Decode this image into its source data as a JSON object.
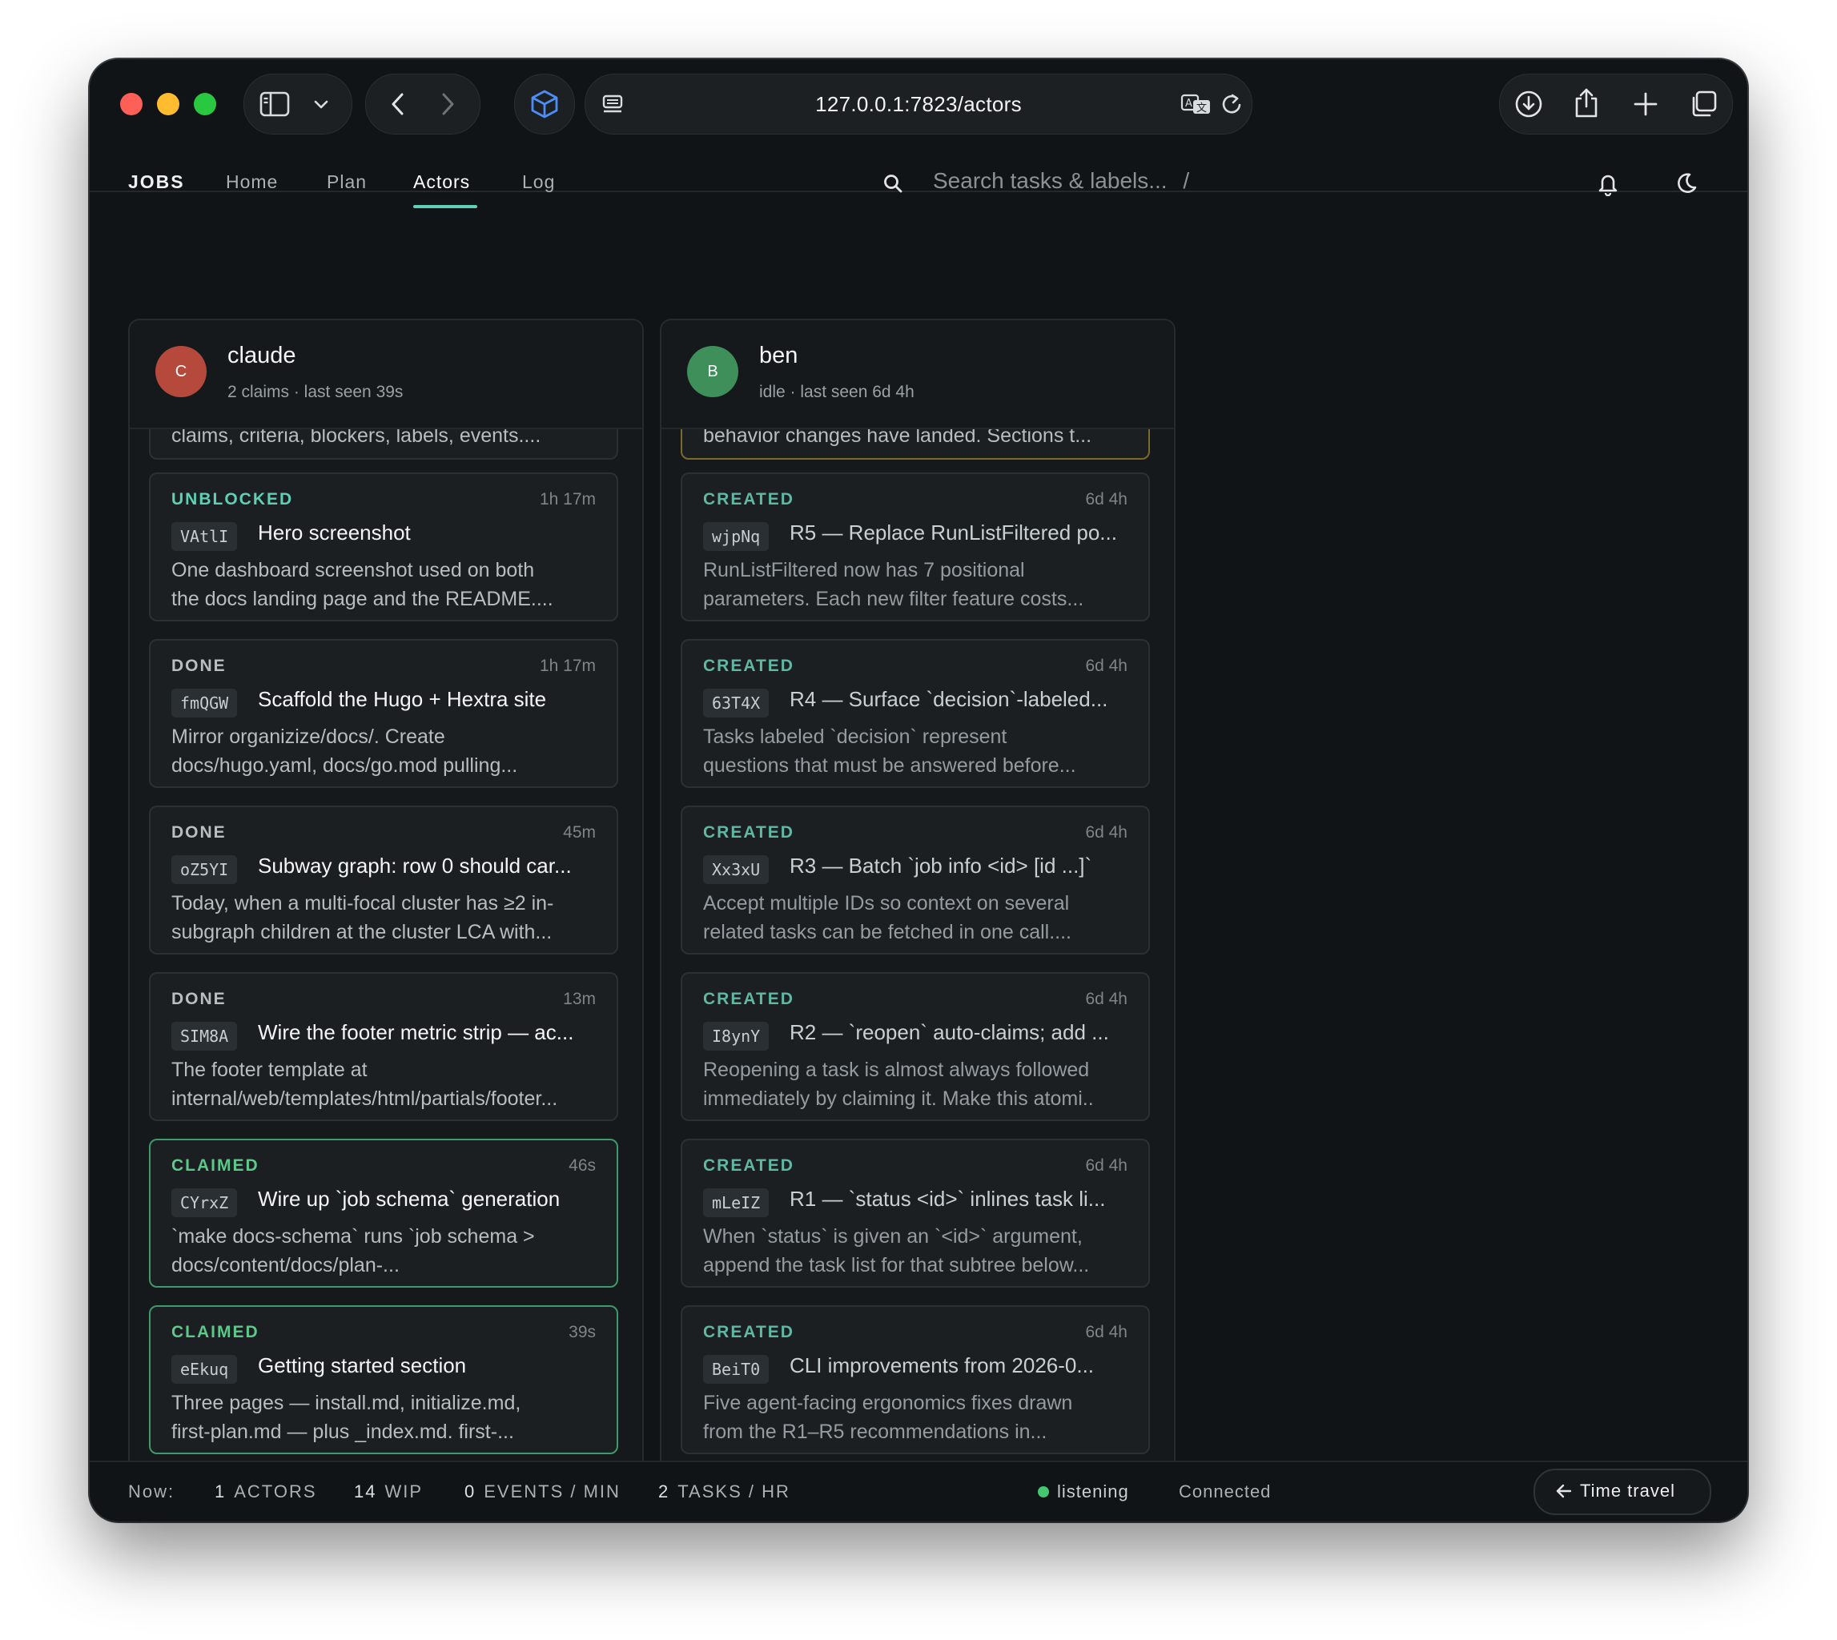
{
  "browser": {
    "url": "127.0.0.1:7823/actors"
  },
  "nav": {
    "brand": "JOBS",
    "items": [
      {
        "label": "Home"
      },
      {
        "label": "Plan"
      },
      {
        "label": "Actors",
        "active": true
      },
      {
        "label": "Log"
      }
    ],
    "search_placeholder": "Search tasks & labels...",
    "search_shortcut": "/"
  },
  "icons": {
    "sidebar": "sidebar-icon",
    "back": "chevron-left-icon",
    "forward": "chevron-right-icon",
    "extension": "cube-icon",
    "reader": "reader-icon",
    "translate": "translate-icon",
    "reload": "reload-icon",
    "download": "download-icon",
    "share": "share-icon",
    "new_tab": "plus-icon",
    "tabs": "tabs-icon",
    "search": "search-icon",
    "bell": "bell-icon",
    "theme": "moon-icon"
  },
  "colors": {
    "accent": "#5fd0b5",
    "claimed": "#5cc98a",
    "avatar_claude": "#b5493b",
    "avatar_ben": "#3f8f5a"
  },
  "actors": [
    {
      "initial": "C",
      "name": "claude",
      "meta": "2 claims · last seen 39s",
      "partial_text": "claims, criteria, blockers, labels, events....",
      "cards": [
        {
          "status": "UNBLOCKED",
          "age": "1h 17m",
          "id": "VAtlI",
          "title": "Hero screenshot",
          "desc_1": "One dashboard screenshot used on both",
          "desc_2": "the docs landing page and the README...."
        },
        {
          "status": "DONE",
          "age": "1h 17m",
          "id": "fmQGW",
          "title": "Scaffold the Hugo + Hextra site",
          "desc_1": "Mirror organizize/docs/. Create",
          "desc_2": "docs/hugo.yaml, docs/go.mod pulling..."
        },
        {
          "status": "DONE",
          "age": "45m",
          "id": "oZ5YI",
          "title": "Subway graph: row 0 should car...",
          "desc_1": "Today, when a multi-focal cluster has ≥2 in-",
          "desc_2": "subgraph children at the cluster LCA with..."
        },
        {
          "status": "DONE",
          "age": "13m",
          "id": "SIM8A",
          "title": "Wire the footer metric strip — ac...",
          "desc_1": "The footer template at",
          "desc_2": "internal/web/templates/html/partials/footer..."
        },
        {
          "status": "CLAIMED",
          "age": "46s",
          "id": "CYrxZ",
          "title": "Wire up `job schema` generation",
          "desc_1": "`make docs-schema` runs `job schema >",
          "desc_2": "docs/content/docs/plan-..."
        },
        {
          "status": "CLAIMED",
          "age": "39s",
          "id": "eEkuq",
          "title": "Getting started section",
          "desc_1": "Three pages — install.md, initialize.md,",
          "desc_2": "first-plan.md — plus _index.md. first-..."
        }
      ]
    },
    {
      "initial": "B",
      "name": "ben",
      "meta": "idle · last seen 6d 4h",
      "partial_text": "behavior changes have landed. Sections t...",
      "cards": [
        {
          "status": "CREATED",
          "age": "6d 4h",
          "id": "wjpNq",
          "title": "R5 — Replace RunListFiltered po...",
          "desc_1": "RunListFiltered now has 7 positional",
          "desc_2": "parameters. Each new filter feature costs..."
        },
        {
          "status": "CREATED",
          "age": "6d 4h",
          "id": "63T4X",
          "title": "R4 — Surface `decision`-labeled...",
          "desc_1": "Tasks labeled `decision` represent",
          "desc_2": "questions that must be answered before..."
        },
        {
          "status": "CREATED",
          "age": "6d 4h",
          "id": "Xx3xU",
          "title": "R3 — Batch `job info <id> [id ...]`",
          "desc_1": "Accept multiple IDs so context on several",
          "desc_2": "related tasks can be fetched in one call...."
        },
        {
          "status": "CREATED",
          "age": "6d 4h",
          "id": "I8ynY",
          "title": "R2 — `reopen` auto-claims; add ...",
          "desc_1": "Reopening a task is almost always followed",
          "desc_2": "immediately by claiming it. Make this atomi.."
        },
        {
          "status": "CREATED",
          "age": "6d 4h",
          "id": "mLeIZ",
          "title": "R1 — `status <id>` inlines task li...",
          "desc_1": "When `status` is given an `<id>` argument,",
          "desc_2": "append the task list for that subtree below..."
        },
        {
          "status": "CREATED",
          "age": "6d 4h",
          "id": "BeiT0",
          "title": "CLI improvements from 2026-0...",
          "desc_1": "Five agent-facing ergonomics fixes drawn",
          "desc_2": "from the R1–R5 recommendations in..."
        }
      ]
    }
  ],
  "footer": {
    "now_label": "Now:",
    "actors_value": "1",
    "actors_label": "ACTORS",
    "wip_value": "14",
    "wip_label": "WIP",
    "events_value": "0",
    "events_label": "EVENTS / MIN",
    "tasks_value": "2",
    "tasks_label": "TASKS / HR",
    "live_label": "listening",
    "connection": "Connected",
    "time_travel": "Time travel"
  }
}
